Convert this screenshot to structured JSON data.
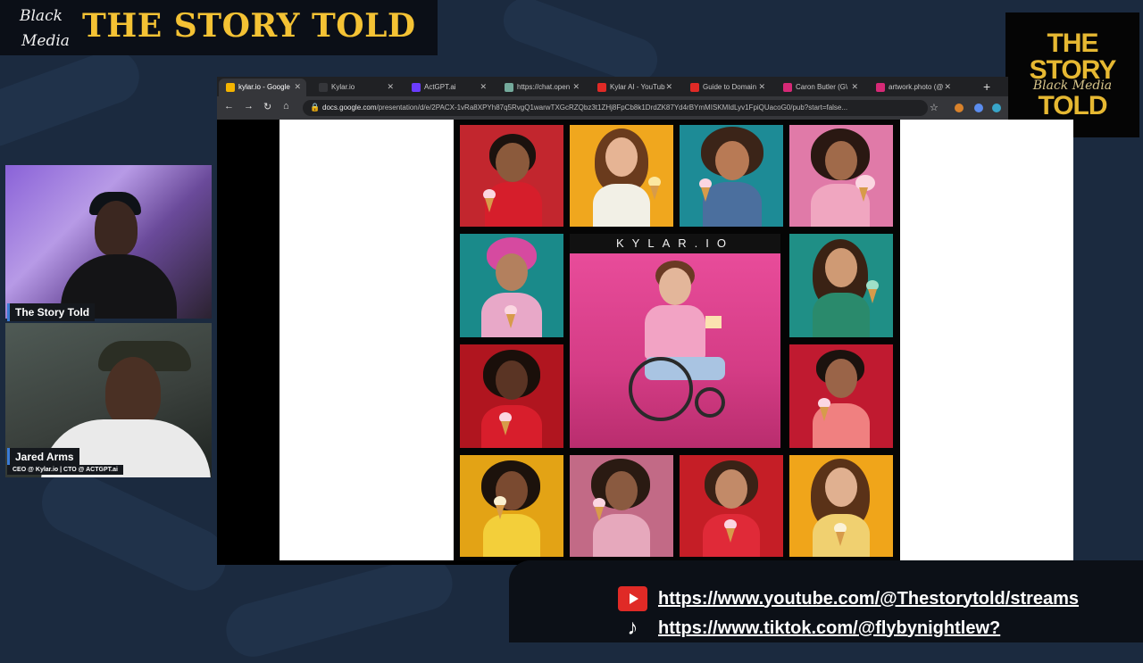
{
  "banner": {
    "brand_line1": "Black",
    "brand_line2": "Media",
    "title": "THE STORY TOLD"
  },
  "logo": {
    "line1": "THE STORY",
    "line2": "TOLD",
    "script": "Black Media"
  },
  "participants": [
    {
      "name": "The Story Told",
      "role": ""
    },
    {
      "name": "Jared Arms",
      "role": "CEO @ Kylar.io | CTO @ ACTGPT.ai"
    }
  ],
  "browser": {
    "tabs": [
      {
        "label": "kylar.io - Google",
        "icon": "slides-icon",
        "color": "#f4b400"
      },
      {
        "label": "Kylar.io",
        "icon": "page-icon",
        "color": "#35363a"
      },
      {
        "label": "ActGPT.ai",
        "icon": "actgpt-icon",
        "color": "#6a3cff"
      },
      {
        "label": "https://chat.open",
        "icon": "chat-icon",
        "color": "#74aa9c"
      },
      {
        "label": "Kylar AI - YouTub",
        "icon": "youtube-icon",
        "color": "#e02a26"
      },
      {
        "label": "Guide to Domain",
        "icon": "youtube-icon",
        "color": "#e02a26"
      },
      {
        "label": "Caron Butler (G\\",
        "icon": "instagram-icon",
        "color": "#d62976"
      },
      {
        "label": "artwork.photo (@",
        "icon": "instagram-icon",
        "color": "#d62976"
      }
    ],
    "active_tab": 0,
    "url_host": "docs.google.com",
    "url_path": "/presentation/d/e/2PACX-1vRa8XPYh87q5RvgQ1warwTXGcRZQbz3t1ZHj8FpCb8k1DrdZK87Yd4rBYmMISKMIdLyv1FpiQUacoG0/pub?start=false..."
  },
  "slide": {
    "brand": "KYLAR.IO"
  },
  "links": {
    "youtube": "https://www.youtube.com/@Thestorytold/streams",
    "tiktok": "https://www.tiktok.com/@flybynightlew?"
  },
  "colors": {
    "accent_gold": "#f4c234",
    "background": "#1b2a3f"
  }
}
